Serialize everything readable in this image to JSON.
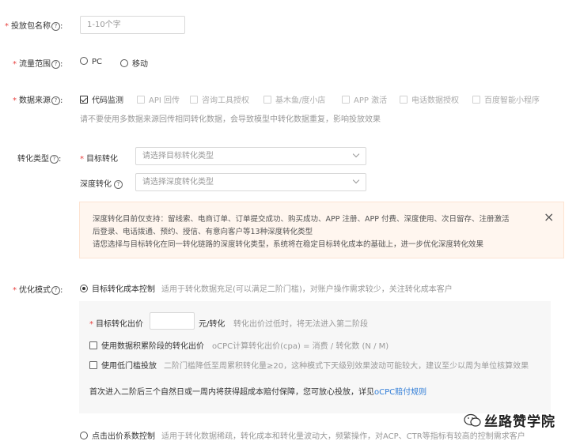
{
  "form": {
    "pkg_name": {
      "label": "投放包名称",
      "placeholder": "1-10个字"
    },
    "traffic": {
      "label": "流量范围",
      "options": [
        "PC",
        "移动"
      ]
    },
    "source": {
      "label": "数据来源",
      "options": [
        "代码监测",
        "API 回传",
        "咨询工具授权",
        "基木鱼/度小店",
        "APP 激活",
        "电话数据授权",
        "百度智能小程序"
      ],
      "hint": "请不要使用多数据来源回传相同转化数据，会导致模型中转化数据重复，影响投放效果"
    },
    "conv_type": {
      "label": "转化类型",
      "target_label": "目标转化",
      "target_placeholder": "请选择目标转化类型",
      "deep_label": "深度转化",
      "deep_placeholder": "请选择深度转化类型"
    },
    "alert": {
      "line1": "深度转化目前仅支持：留线索、电商订单、订单提交成功、购买成功、APP 注册、APP 付费、深度使用、次日留存、注册激活",
      "line2": "后登录、电话拨通、预约、授信、有意向客户等13种深度转化类型",
      "line3": "请您选择与目标转化在同一转化链路的深度转化类型，系统将在稳定目标转化成本的基础上，进一步优化深度转化效果",
      "close": "×"
    },
    "opt_mode": {
      "label": "优化模式",
      "option1": "目标转化成本控制",
      "option1_desc": "适用于转化数据充足(可以满足二阶门槛)，对账户操作需求较少，关注转化成本客户",
      "bid_label": "目标转化出价",
      "bid_unit": "元/转化",
      "bid_hint": "转化出价过低时，将无法进入第二阶段",
      "accum_label": "使用数据积累阶段的转化出价",
      "accum_hint": "oCPC计算转化出价(cpa) = 消费 / 转化数 (N / M)",
      "low_label": "使用低门槛投放",
      "low_hint": "二阶门槛降低至周累积转化量≥20，这种模式下天级别效果波动可能较大，建议至少以周为单位核算效果",
      "notice_prefix": "首次进入二阶后三个自然日或一周内将获得超成本赔付保障，您可放心投放，详见",
      "notice_link": "oCPC赔付规则",
      "option2": "点击出价系数控制",
      "option2_desc": "适用于转化数据稀疏，转化成本和转化量波动大，频繁操作，对ACP、CTR等指标有较高的控制需求客户"
    }
  },
  "watermark": "丝路赞学院"
}
